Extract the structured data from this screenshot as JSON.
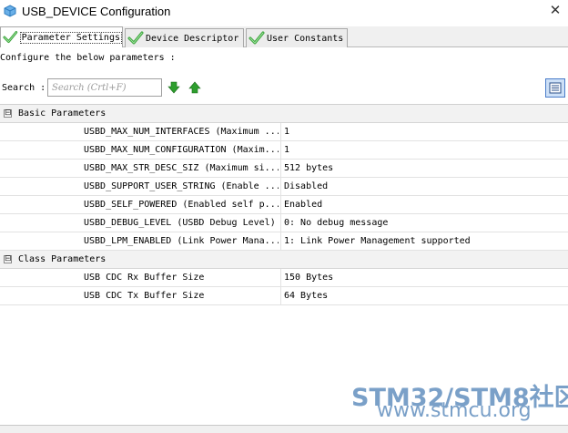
{
  "window": {
    "title": "USB_DEVICE Configuration",
    "close_symbol": "✕",
    "icon": "cube-app-icon"
  },
  "tabs": [
    {
      "label": "Parameter Settings",
      "active": true,
      "icon": "green-check-icon"
    },
    {
      "label": "Device Descriptor",
      "active": false,
      "icon": "green-check-icon"
    },
    {
      "label": "User Constants",
      "active": false,
      "icon": "green-check-icon"
    }
  ],
  "configure_text": "Configure the below parameters :",
  "search": {
    "label": "Search :",
    "placeholder": "Search (Crtl+F)",
    "next_icon": "green-down-arrow-icon",
    "prev_icon": "green-up-arrow-icon",
    "view_icon": "list-view-icon"
  },
  "groups": [
    {
      "label": "Basic Parameters",
      "expander": "⊟",
      "params": [
        {
          "name": "USBD_MAX_NUM_INTERFACES (Maximum ...",
          "value": "1"
        },
        {
          "name": "USBD_MAX_NUM_CONFIGURATION (Maxim...",
          "value": "1"
        },
        {
          "name": "USBD_MAX_STR_DESC_SIZ (Maximum si...",
          "value": "512 bytes"
        },
        {
          "name": "USBD_SUPPORT_USER_STRING (Enable ...",
          "value": "Disabled"
        },
        {
          "name": "USBD_SELF_POWERED (Enabled self p...",
          "value": "Enabled"
        },
        {
          "name": "USBD_DEBUG_LEVEL (USBD Debug Level)",
          "value": "0: No debug message"
        },
        {
          "name": "USBD_LPM_ENABLED (Link Power Mana...",
          "value": "1: Link Power Management supported"
        }
      ]
    },
    {
      "label": "Class Parameters",
      "expander": "⊟",
      "params": [
        {
          "name": "USB CDC Rx Buffer Size",
          "value": "150 Bytes"
        },
        {
          "name": "USB CDC Tx Buffer Size",
          "value": "64 Bytes"
        }
      ]
    }
  ],
  "watermark": {
    "main": "STM32/STM8社区",
    "url": "www.stmcu.org"
  },
  "colors": {
    "check_green": "#3aa23a",
    "arrow_green": "#2e9e2e",
    "watermark": "#7aa0c8",
    "selected_blue": "#4a7cc9"
  }
}
